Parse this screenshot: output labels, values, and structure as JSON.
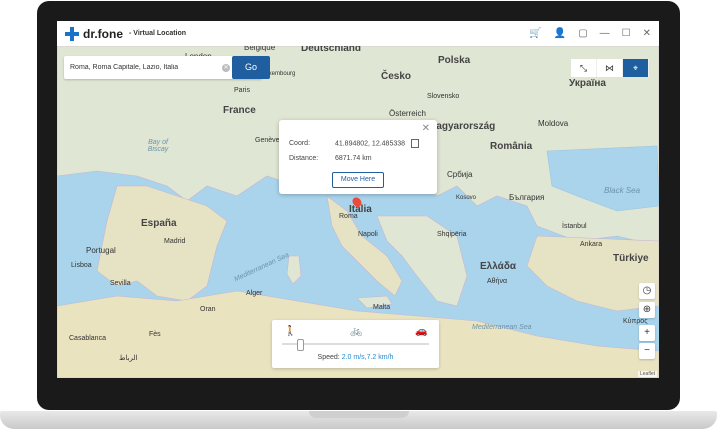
{
  "app": {
    "brand": "dr.fone",
    "subtitle": "- Virtual Location"
  },
  "search": {
    "value": "Roma, Roma Capitale, Lazio, Italia",
    "go_label": "Go"
  },
  "popup": {
    "coord_label": "Coord:",
    "coord_value": "41.894802, 12.485338",
    "distance_label": "Distance:",
    "distance_value": "6871.74 km",
    "move_button": "Move Here"
  },
  "speed": {
    "label": "Speed:",
    "value": "2.0 m/s,7.2 km/h"
  },
  "map_labels": {
    "london": "London",
    "belgique": "Belgique",
    "deutschland": "Deutschland",
    "luxembourg": "Luxembourg",
    "cesko": "Česko",
    "polska": "Polska",
    "ukraina": "Україна",
    "slovensko": "Slovensko",
    "paris": "Paris",
    "france": "France",
    "osterreich": "Österreich",
    "magyarorszag": "Magyarország",
    "moldova": "Moldova",
    "geneve": "Genève",
    "romania": "România",
    "bay_of_biscay": "Bay of Biscay",
    "srbija": "Србија",
    "black_sea": "Black Sea",
    "bulgaria": "България",
    "italia": "Italia",
    "roma": "Roma",
    "kosovo": "Kosovo",
    "espana": "España",
    "madrid": "Madrid",
    "napoli": "Napoli",
    "shqiperia": "Shqipëria",
    "istanbul": "İstanbul",
    "portugal": "Portugal",
    "lisboa": "Lisboa",
    "ellada": "Ελλάδα",
    "ankara": "Ankara",
    "turkiye": "Türkiye",
    "sevilla": "Sevilla",
    "athina": "Αθήνα",
    "mediterranean_sea": "Mediterranean Sea",
    "alger": "Alger",
    "oran": "Oran",
    "malta": "Malta",
    "kibris": "Κύπρος",
    "casablanca": "Casablanca",
    "fes": "Fès",
    "rabat": "الرباط",
    "mediterranean_sea_2": "Mediterranean Sea"
  },
  "attribution": "Leaflet",
  "colors": {
    "accent": "#1f5e9f",
    "sea": "#a9d4ec",
    "land": "#dfe6d3",
    "pin": "#e74c3c"
  }
}
